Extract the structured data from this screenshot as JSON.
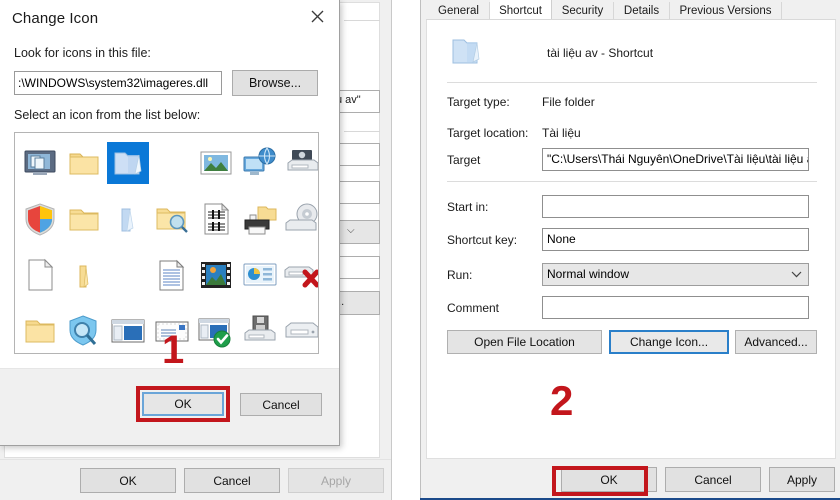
{
  "change_icon_dialog": {
    "title": "Change Icon",
    "close_icon": "close-icon",
    "look_for_label": "Look for icons in this file:",
    "path_value": ":\\WINDOWS\\system32\\imageres.dll",
    "browse_label": "Browse...",
    "select_icon_label": "Select an icon from the list below:",
    "ok_label": "OK",
    "cancel_label": "Cancel",
    "scrollbar": {
      "left_arrow": "‹",
      "right_arrow": "›"
    },
    "icon_grid": {
      "rows": [
        [
          {
            "name": "remote-desktop-icon",
            "selected": false
          },
          {
            "name": "folder-open-icon",
            "selected": false
          },
          {
            "name": "folder-shortcut-blue-icon",
            "selected": true
          },
          {
            "name": "empty-cell",
            "selected": false
          },
          {
            "name": "picture-frame-icon",
            "selected": false
          },
          {
            "name": "network-monitor-icon",
            "selected": false
          },
          {
            "name": "disk-drive-icon",
            "selected": false
          }
        ],
        [
          {
            "name": "windows-shield-icon",
            "selected": false
          },
          {
            "name": "folder-closed-icon",
            "selected": false
          },
          {
            "name": "folder-blue-icon",
            "selected": false
          },
          {
            "name": "folder-search-icon",
            "selected": false
          },
          {
            "name": "music-document-icon",
            "selected": false
          },
          {
            "name": "printer-folder-icon",
            "selected": false
          },
          {
            "name": "optical-drive-icon",
            "selected": false
          }
        ],
        [
          {
            "name": "blank-document-icon",
            "selected": false
          },
          {
            "name": "folder-thin-icon",
            "selected": false
          },
          {
            "name": "empty-cell",
            "selected": false
          },
          {
            "name": "lined-document-icon",
            "selected": false
          },
          {
            "name": "film-strip-icon",
            "selected": false
          },
          {
            "name": "presentation-icon",
            "selected": false
          },
          {
            "name": "drive-error-icon",
            "selected": false
          }
        ],
        [
          {
            "name": "folder-plain-icon",
            "selected": false
          },
          {
            "name": "shield-search-icon",
            "selected": false
          },
          {
            "name": "window-pane-icon",
            "selected": false
          },
          {
            "name": "mail-envelope-icon",
            "selected": false
          },
          {
            "name": "window-check-icon",
            "selected": false
          },
          {
            "name": "floppy-drive-icon",
            "selected": false
          },
          {
            "name": "hard-drive-icon",
            "selected": false
          }
        ]
      ]
    }
  },
  "markers": {
    "step_one": "1",
    "step_two": "2"
  },
  "properties_window": {
    "tabs": [
      {
        "label": "General",
        "active": false
      },
      {
        "label": "Shortcut",
        "active": true
      },
      {
        "label": "Security",
        "active": false
      },
      {
        "label": "Details",
        "active": false
      },
      {
        "label": "Previous Versions",
        "active": false
      }
    ],
    "shortcut_name": "tài liệu av - Shortcut",
    "shortcut_icon": "folder-shortcut-icon",
    "rows": [
      {
        "label": "Target type:",
        "value": "File folder"
      },
      {
        "label": "Target location:",
        "value": "Tài liệu"
      }
    ],
    "target_label": "Target",
    "target_value": "\"C:\\Users\\Thái Nguyên\\OneDrive\\Tài liệu\\tài liệu av\"",
    "start_in_label": "Start in:",
    "start_in_value": "",
    "shortcut_key_label": "Shortcut key:",
    "shortcut_key_value": "None",
    "run_label": "Run:",
    "run_value": "Normal window",
    "run_arrow_icon": "chevron-down-icon",
    "comment_label": "Comment",
    "comment_value": "",
    "open_file_location_label": "Open File Location",
    "change_icon_label": "Change Icon...",
    "advanced_label": "Advanced...",
    "ok_label": "OK",
    "cancel_label": "Cancel",
    "apply_label": "Apply"
  },
  "background_window": {
    "target_fragment": "u av\"",
    "combo_arrow_icon": "chevron-down-icon",
    "button_fragment": "...",
    "ok_label": "OK",
    "cancel_label": "Cancel",
    "apply_label": "Apply"
  },
  "colors": {
    "accent_red": "#c3161c",
    "selection_blue": "#0a78d7",
    "focus_blue": "#2a7fc9",
    "window_grey": "#f0f0f0"
  }
}
